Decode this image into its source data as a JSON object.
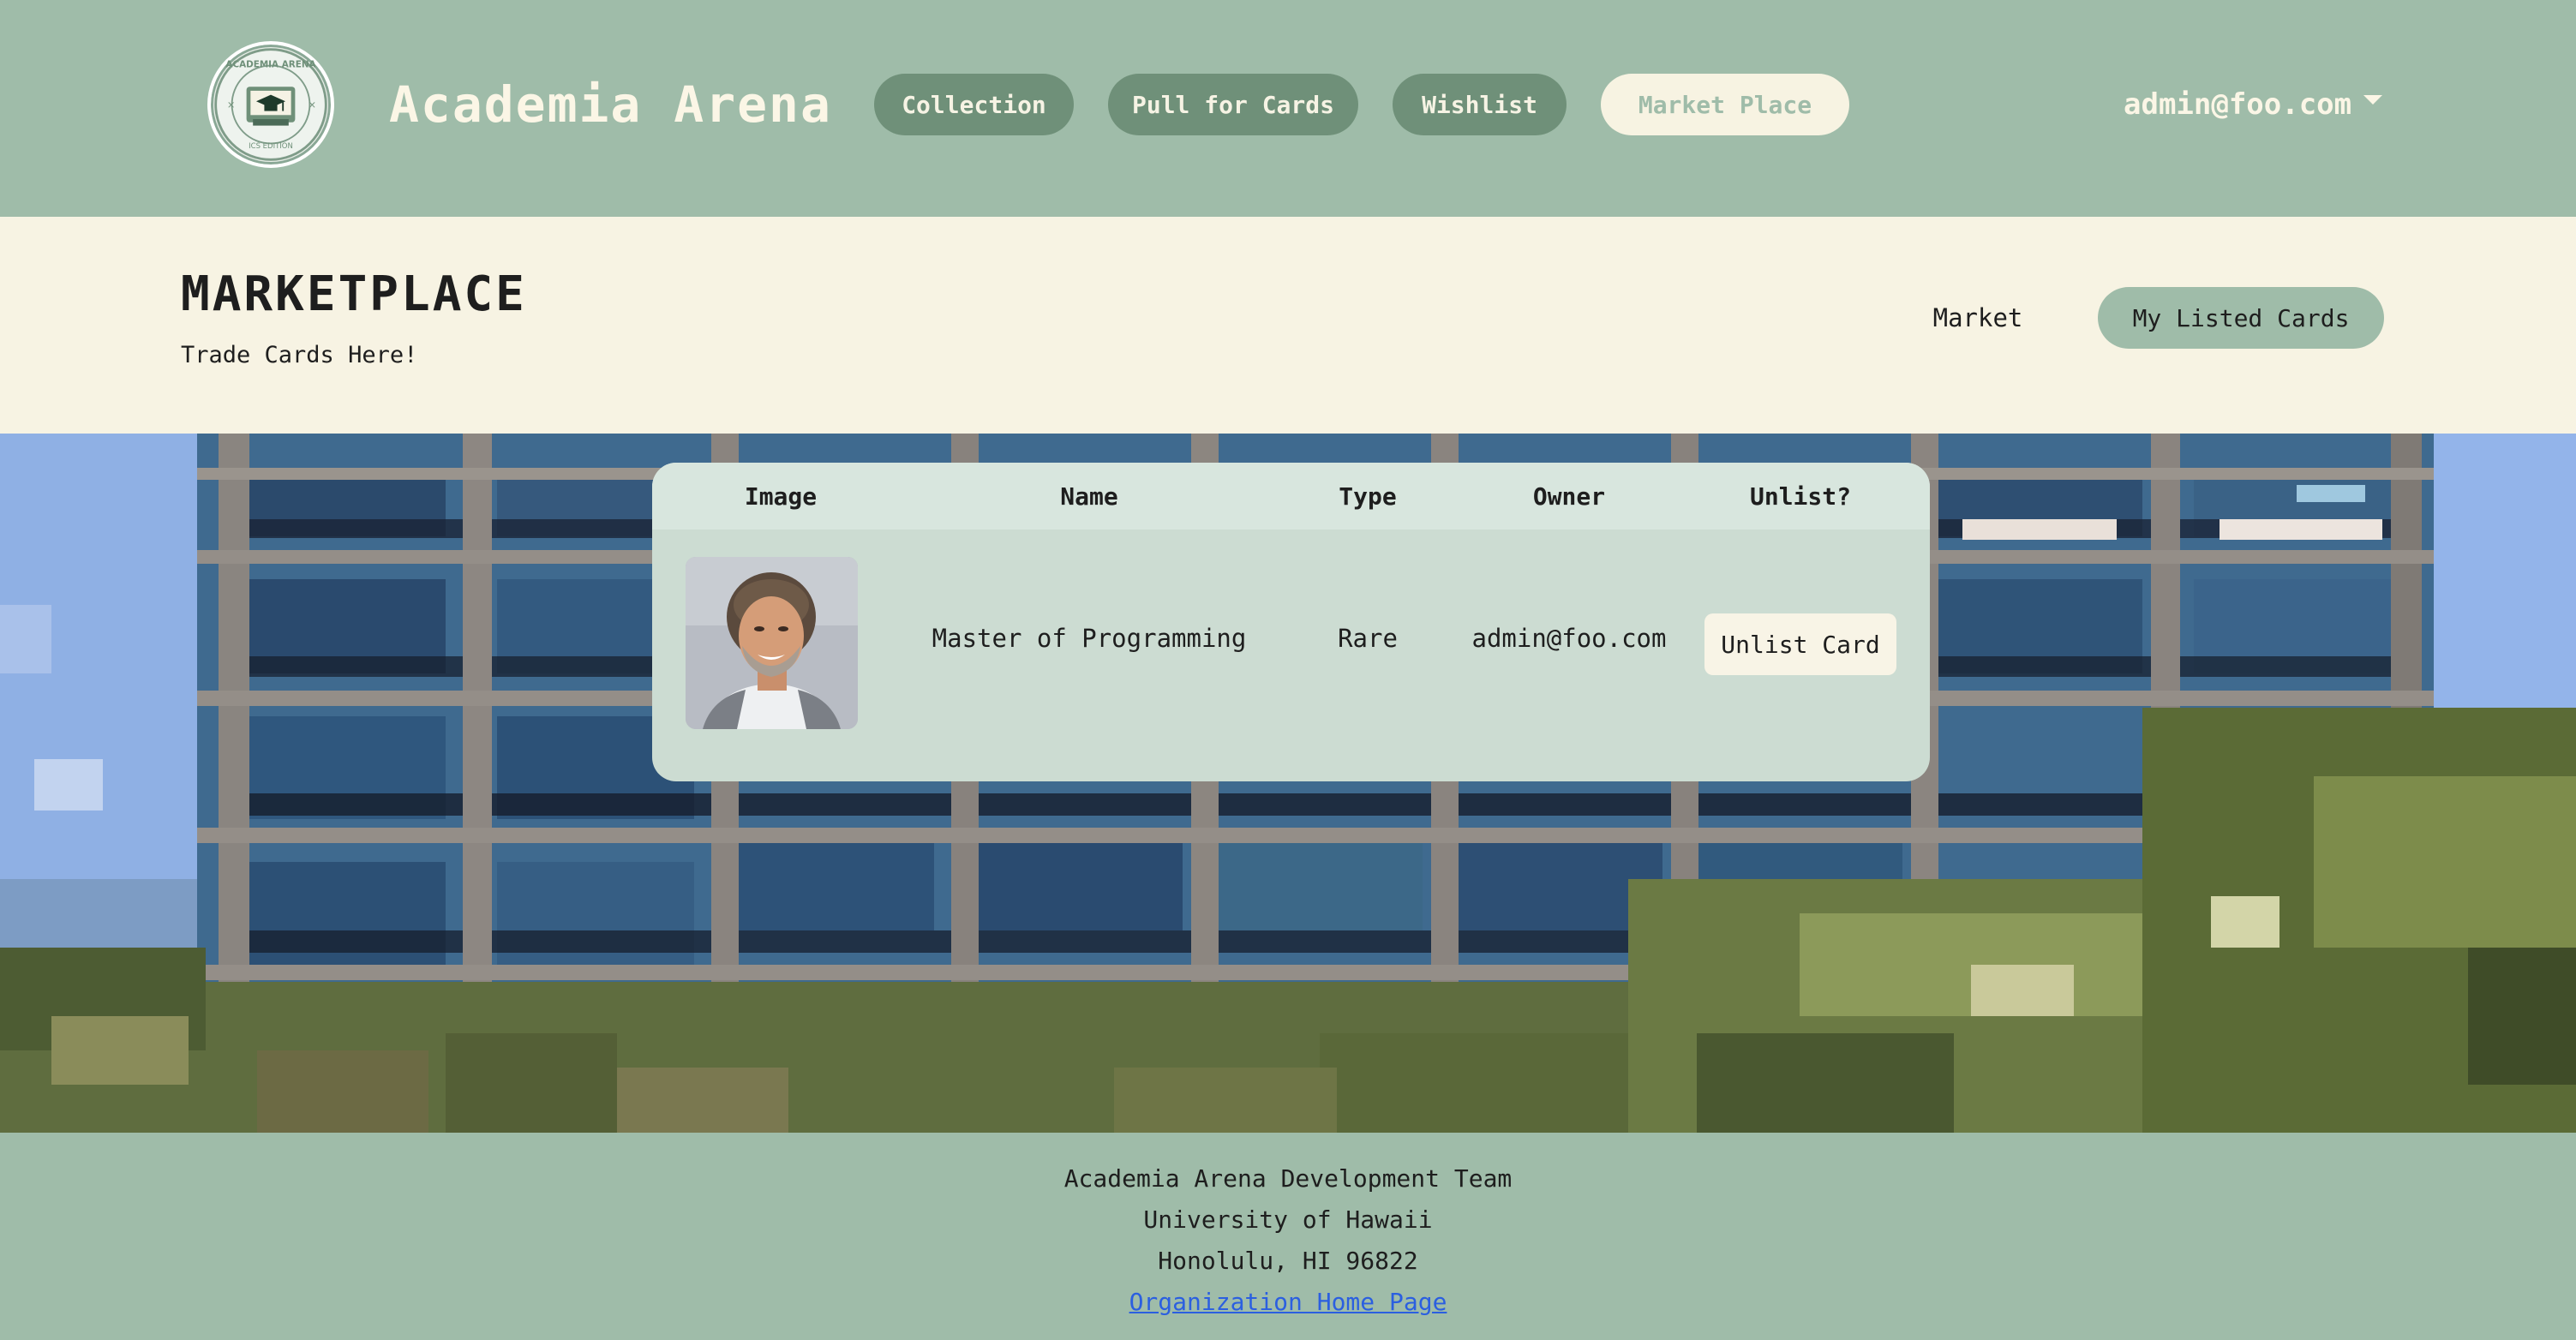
{
  "navbar": {
    "brand": "Academia Arena",
    "logo": {
      "icon": "graduation-cap-icon",
      "top_text": "ACADEMIA ARENA",
      "bottom_text": "ICS EDITION"
    },
    "links": [
      {
        "label": "Collection"
      },
      {
        "label": "Pull for Cards"
      },
      {
        "label": "Wishlist"
      },
      {
        "label": "Market Place"
      }
    ],
    "active_link": "Market Place",
    "user": "admin@foo.com"
  },
  "page": {
    "title": "MARKETPLACE",
    "subtitle": "Trade Cards Here!",
    "tabs": {
      "market": "Market",
      "my_listed": "My Listed Cards"
    },
    "selected_tab": "My Listed Cards"
  },
  "table": {
    "headers": {
      "image": "Image",
      "name": "Name",
      "type": "Type",
      "owner": "Owner",
      "unlist": "Unlist?"
    },
    "rows": [
      {
        "image_icon": "professor-portrait",
        "name": "Master of Programming",
        "type": "Rare",
        "owner": "admin@foo.com",
        "action": "Unlist Card"
      }
    ]
  },
  "footer": {
    "team": "Academia Arena Development Team",
    "university": "University of Hawaii",
    "location": "Honolulu, HI 96822",
    "link_label": "Organization Home Page"
  },
  "colors": {
    "sage": "#9fbca9",
    "nav_pill": "#6f9079",
    "cream": "#f7f3e3",
    "table_bg": "#ccdcd2",
    "link": "#2b5fe0"
  }
}
